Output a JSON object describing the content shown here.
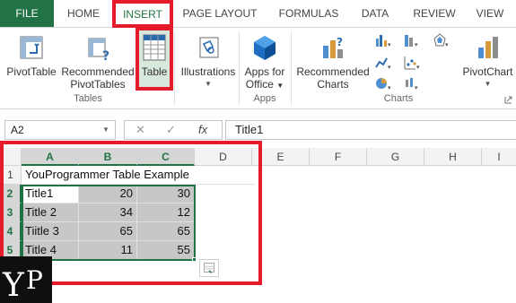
{
  "tabs": {
    "file": "FILE",
    "home": "HOME",
    "insert": "INSERT",
    "page_layout": "PAGE LAYOUT",
    "formulas": "FORMULAS",
    "data": "DATA",
    "review": "REVIEW",
    "view": "VIEW"
  },
  "ribbon": {
    "pivottable": "PivotTable",
    "recommended_pivottables_1": "Recommended",
    "recommended_pivottables_2": "PivotTables",
    "table": "Table",
    "illustrations": "Illustrations",
    "apps_for_office_1": "Apps for",
    "apps_for_office_2": "Office",
    "recommended_charts_1": "Recommended",
    "recommended_charts_2": "Charts",
    "pivotchart": "PivotChart",
    "group_tables": "Tables",
    "group_apps": "Apps",
    "group_charts": "Charts"
  },
  "formula_bar": {
    "name_box": "A2",
    "cancel_icon": "✕",
    "enter_icon": "✓",
    "fx_label": "fx",
    "value": "Title1"
  },
  "grid": {
    "columns": [
      "A",
      "B",
      "C",
      "D",
      "E",
      "F",
      "G",
      "H",
      "I"
    ],
    "rows": [
      "1",
      "2",
      "3",
      "4",
      "5"
    ],
    "title_cell": "YouProgrammer Table Example",
    "data": [
      {
        "a": "Title1",
        "b": "20",
        "c": "30"
      },
      {
        "a": "Title 2",
        "b": "34",
        "c": "12"
      },
      {
        "a": "Tiitle 3",
        "b": "65",
        "c": "65"
      },
      {
        "a": "Title 4",
        "b": "11",
        "c": "55"
      }
    ]
  },
  "logo": {
    "text_y": "Y",
    "text_p": "P"
  },
  "colors": {
    "excel_green": "#217346",
    "highlight_red": "#e51a2b",
    "selection_gray": "#c7c7c7"
  }
}
